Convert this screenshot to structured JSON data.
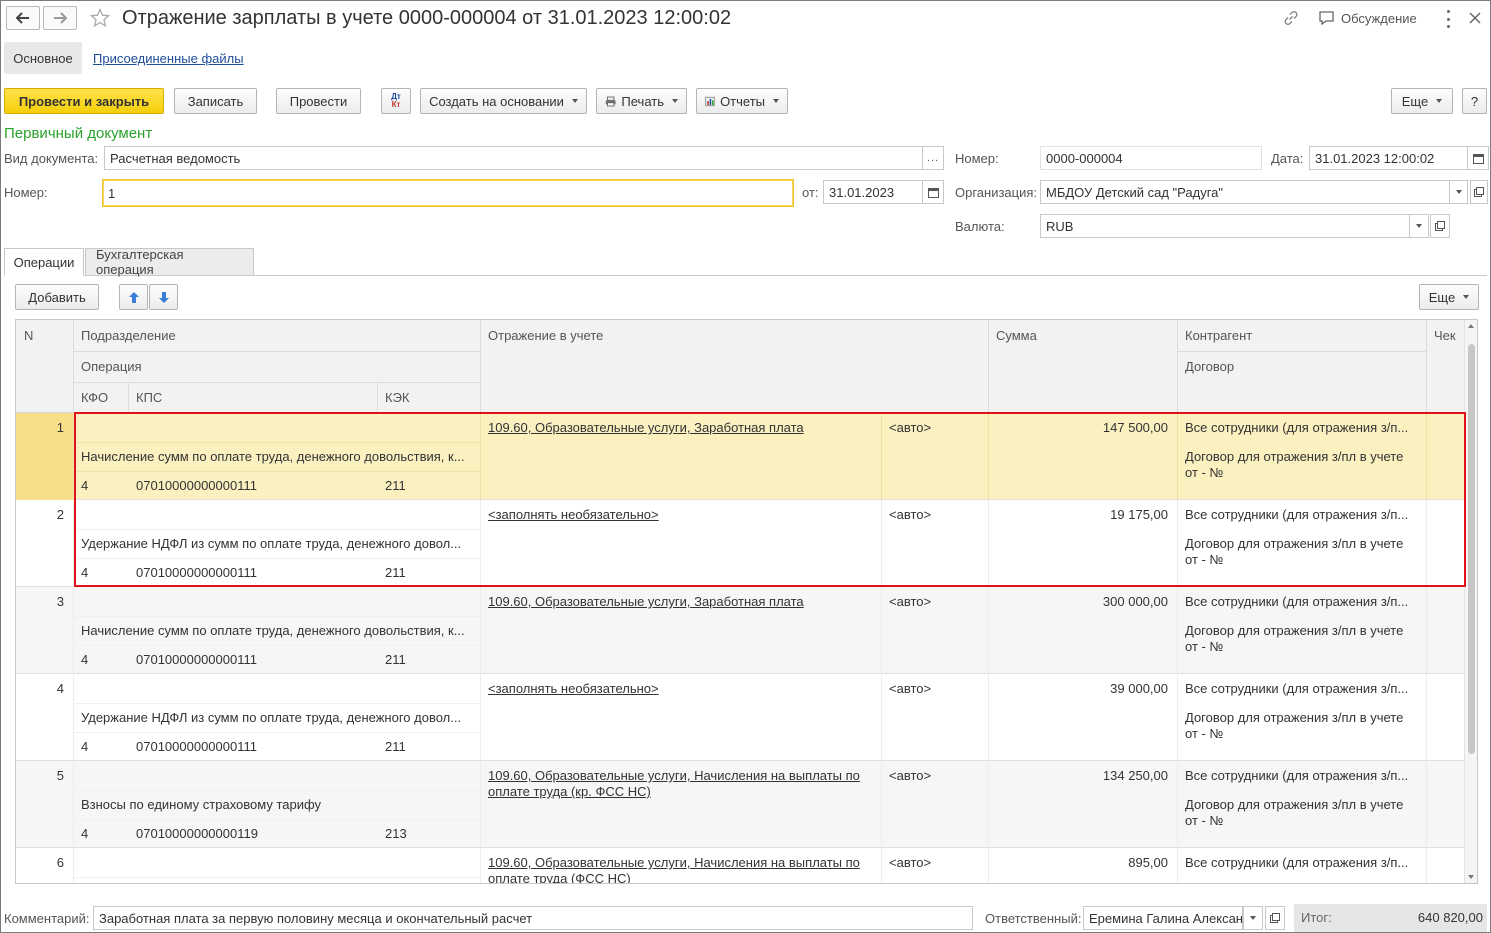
{
  "window": {
    "title": "Отражение зарплаты в учете 0000-000004 от 31.01.2023 12:00:02",
    "discussion": "Обсуждение"
  },
  "nav_tabs": {
    "main": "Основное",
    "files": "Присоединенные файлы"
  },
  "toolbar": {
    "post_close": "Провести и закрыть",
    "save": "Записать",
    "post": "Провести",
    "dtkt_icon": "Дт Кт",
    "create_based": "Создать на основании",
    "print": "Печать",
    "reports": "Отчеты",
    "more": "Еще",
    "help": "?"
  },
  "primary_doc": {
    "heading": "Первичный документ",
    "doc_type_label": "Вид документа:",
    "doc_type_value": "Расчетная ведомость",
    "number_label": "Номер:",
    "number_value": "1",
    "from_label": "от:",
    "from_value": "31.01.2023"
  },
  "header": {
    "number_label": "Номер:",
    "number_value": "0000-000004",
    "date_label": "Дата:",
    "date_value": "31.01.2023 12:00:02",
    "org_label": "Организация:",
    "org_value": "МБДОУ Детский сад \"Радуга\"",
    "currency_label": "Валюта:",
    "currency_value": "RUB"
  },
  "tabs": {
    "operations": "Операции",
    "accounting": "Бухгалтерская операция"
  },
  "table_toolbar": {
    "add": "Добавить",
    "more": "Еще"
  },
  "table": {
    "headers": {
      "n": "N",
      "department": "Подразделение",
      "operation": "Операция",
      "kfo": "КФО",
      "kps": "КПС",
      "kek": "КЭК",
      "reflection": "Отражение в учете",
      "sum": "Сумма",
      "counterparty": "Контрагент",
      "contract": "Договор",
      "check": "Чек"
    },
    "rows": [
      {
        "n": "1",
        "operation": "Начисление сумм по оплате труда, денежного довольствия, к...",
        "kfo": "4",
        "kps": "07010000000000111",
        "kek": "211",
        "reflection1": "109.60, Образовательные услуги, Заработная плата",
        "reflection2": "",
        "auto": "<авто>",
        "sum": "147 500,00",
        "counterparty": "Все сотрудники (для отражения з/п...",
        "contract1": "Договор для отражения з/пл в учете",
        "contract2": "от - №",
        "reflection_link": true
      },
      {
        "n": "2",
        "operation": "Удержание НДФЛ из сумм по оплате труда, денежного довол...",
        "kfo": "4",
        "kps": "07010000000000111",
        "kek": "211",
        "reflection1": "<заполнять необязательно>",
        "reflection2": "",
        "auto": "<авто>",
        "sum": "19 175,00",
        "counterparty": "Все сотрудники (для отражения з/п...",
        "contract1": "Договор для отражения з/пл в учете",
        "contract2": "от - №",
        "reflection_link": true
      },
      {
        "n": "3",
        "operation": "Начисление сумм по оплате труда, денежного довольствия, к...",
        "kfo": "4",
        "kps": "07010000000000111",
        "kek": "211",
        "reflection1": "109.60, Образовательные услуги, Заработная плата",
        "reflection2": "",
        "auto": "<авто>",
        "sum": "300 000,00",
        "counterparty": "Все сотрудники (для отражения з/п...",
        "contract1": "Договор для отражения з/пл в учете",
        "contract2": "от - №",
        "reflection_link": true
      },
      {
        "n": "4",
        "operation": "Удержание НДФЛ из сумм по оплате труда, денежного довол...",
        "kfo": "4",
        "kps": "07010000000000111",
        "kek": "211",
        "reflection1": "<заполнять необязательно>",
        "reflection2": "",
        "auto": "<авто>",
        "sum": "39 000,00",
        "counterparty": "Все сотрудники (для отражения з/п...",
        "contract1": "Договор для отражения з/пл в учете",
        "contract2": "от - №",
        "reflection_link": true
      },
      {
        "n": "5",
        "operation": "Взносы по единому страховому тарифу",
        "kfo": "4",
        "kps": "07010000000000119",
        "kek": "213",
        "reflection1": "109.60, Образовательные услуги, Начисления на выплаты по",
        "reflection2": "оплате труда (кр. ФСС НС)",
        "auto": "<авто>",
        "sum": "134 250,00",
        "counterparty": "Все сотрудники (для отражения з/п...",
        "contract1": "Договор для отражения з/пл в учете",
        "contract2": "от - №",
        "reflection_link": true
      },
      {
        "n": "6",
        "operation": "",
        "kfo": "",
        "kps": "",
        "kek": "",
        "reflection1": "109.60, Образовательные услуги, Начисления на выплаты по",
        "reflection2": "оплате труда (ФСС НС)",
        "auto": "<авто>",
        "sum": "895,00",
        "counterparty": "Все сотрудники (для отражения з/п...",
        "contract1": "",
        "contract2": "",
        "reflection_link": true
      }
    ]
  },
  "footer": {
    "comment_label": "Комментарий:",
    "comment_value": "Заработная плата за первую половину месяца и окончательный расчет",
    "responsible_label": "Ответственный:",
    "responsible_value": "Еремина Галина Александ",
    "total_label": "Итог:",
    "total_value": "640 820,00"
  },
  "colors": {
    "accent_yellow": "#f5cf0a",
    "selected_row": "#fbf0c0",
    "green_heading": "#2aa12a",
    "highlight_red": "#e0121b"
  }
}
